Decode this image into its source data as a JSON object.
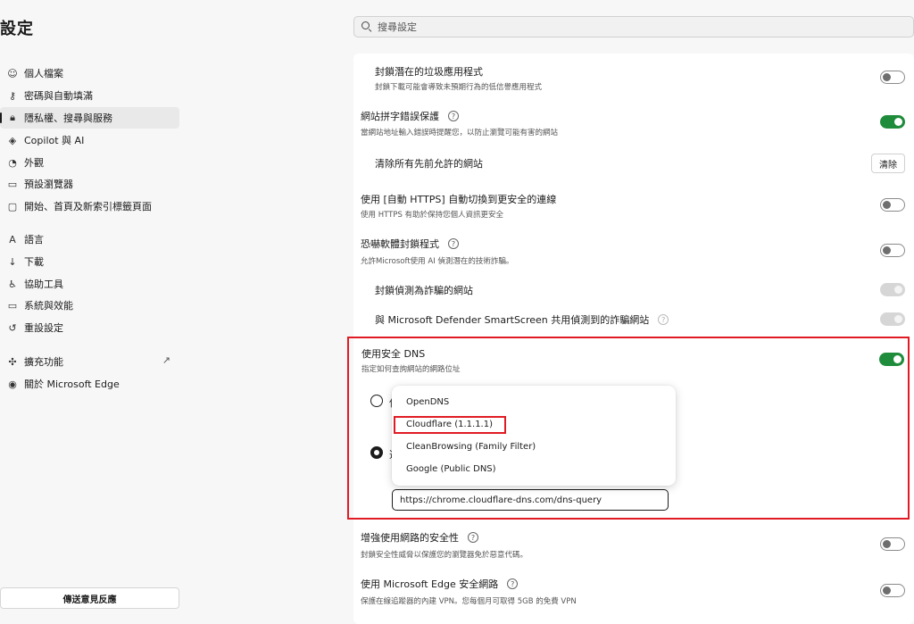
{
  "page_title": "設定",
  "search": {
    "placeholder": "搜尋設定"
  },
  "sidebar": {
    "items": [
      {
        "icon": "profile-icon",
        "glyph": "☺",
        "label": "個人檔案"
      },
      {
        "icon": "key-icon",
        "glyph": "⚷",
        "label": "密碼與自動填滿"
      },
      {
        "icon": "lock-icon",
        "glyph": "🔒︎",
        "label": "隱私權、搜尋與服務"
      },
      {
        "icon": "copilot-icon",
        "glyph": "◈",
        "label": "Copilot 與 AI"
      },
      {
        "icon": "appearance-icon",
        "glyph": "◔",
        "label": "外觀"
      },
      {
        "icon": "browser-icon",
        "glyph": "▭",
        "label": "預設瀏覽器"
      },
      {
        "icon": "newtab-icon",
        "glyph": "▢",
        "label": "開始、首頁及新索引標籤頁面"
      },
      {
        "icon": "language-icon",
        "glyph": "A",
        "label": "語言"
      },
      {
        "icon": "download-icon",
        "glyph": "↓",
        "label": "下載"
      },
      {
        "icon": "accessibility-icon",
        "glyph": "♿︎",
        "label": "協助工具"
      },
      {
        "icon": "system-icon",
        "glyph": "▭",
        "label": "系統與效能"
      },
      {
        "icon": "reset-icon",
        "glyph": "↺",
        "label": "重設設定"
      },
      {
        "icon": "extensions-icon",
        "glyph": "✣",
        "label": "擴充功能"
      },
      {
        "icon": "edge-icon",
        "glyph": "◉",
        "label": "關於 Microsoft Edge"
      }
    ],
    "feedback": "傳送意見反應"
  },
  "settings": {
    "block_pua": {
      "title": "封鎖潛在的垃圾應用程式",
      "desc": "封鎖下載可能會導致未預期行為的低信譽應用程式",
      "on": false
    },
    "typo": {
      "title": "網站拼字錯誤保護",
      "desc": "當網站地址輸入錯誤時提醒您，以防止瀏覽可能有害的網站",
      "on": true
    },
    "clear_allowed": {
      "title": "清除所有先前允許的網站",
      "button": "清除"
    },
    "auto_https": {
      "title": "使用 [自動 HTTPS] 自動切換到更安全的連線",
      "desc": "使用 HTTPS 有助於保持您個人資訊更安全",
      "on": false
    },
    "scareware": {
      "title": "恐嚇軟體封鎖程式",
      "desc": "允許Microsoft使用 AI 偵測潛在的技術詐騙。",
      "on": false
    },
    "block_scam": {
      "title": "封鎖偵測為詐騙的網站"
    },
    "share_defender": {
      "title": "與 Microsoft Defender SmartScreen 共用偵測到的詐騙網站"
    },
    "secure_dns": {
      "title": "使用安全 DNS",
      "desc": "指定如何查詢網站的網路位址",
      "on": true,
      "radio1_label": "使",
      "radio2_label": "選",
      "url_value": "https://chrome.cloudflare-dns.com/dns-query",
      "providers": [
        "OpenDNS",
        "Cloudflare (1.1.1.1)",
        "CleanBrowsing (Family Filter)",
        "Google (Public DNS)"
      ]
    },
    "enhanced_security": {
      "title": "增強使用網路的安全性",
      "desc": "封鎖安全性威脅以保護您的瀏覽器免於惡意代碼。",
      "on": false
    },
    "edge_network": {
      "title": "使用 Microsoft Edge 安全網路",
      "desc": "保護在線追蹤器的內建 VPN。您每個月可取得 5GB 的免費 VPN",
      "on": false
    }
  },
  "colors": {
    "accent_green": "#1f8c3b",
    "highlight_red": "#e01b24"
  }
}
